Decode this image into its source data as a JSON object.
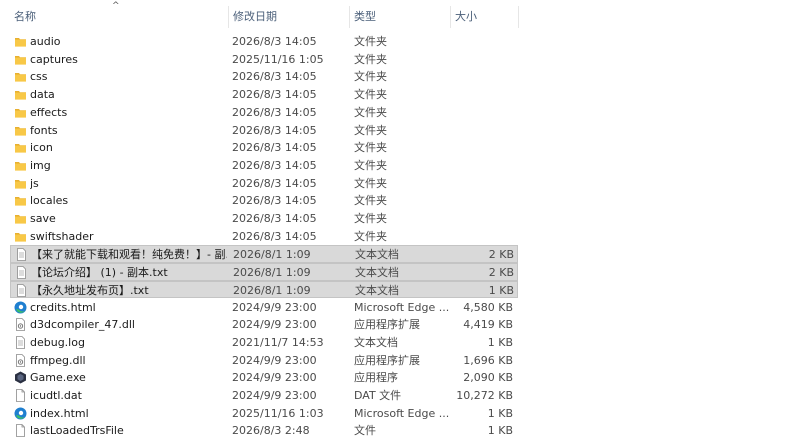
{
  "header": {
    "name": "名称",
    "date": "修改日期",
    "type": "类型",
    "size": "大小",
    "sort_arrow": "^"
  },
  "rows": [
    {
      "icon": "folder-icon",
      "name": "audio",
      "date": "2026/8/3 14:05",
      "type": "文件夹",
      "size": "",
      "selected": false
    },
    {
      "icon": "folder-icon",
      "name": "captures",
      "date": "2025/11/16 1:05",
      "type": "文件夹",
      "size": "",
      "selected": false
    },
    {
      "icon": "folder-icon",
      "name": "css",
      "date": "2026/8/3 14:05",
      "type": "文件夹",
      "size": "",
      "selected": false
    },
    {
      "icon": "folder-icon",
      "name": "data",
      "date": "2026/8/3 14:05",
      "type": "文件夹",
      "size": "",
      "selected": false
    },
    {
      "icon": "folder-icon",
      "name": "effects",
      "date": "2026/8/3 14:05",
      "type": "文件夹",
      "size": "",
      "selected": false
    },
    {
      "icon": "folder-icon",
      "name": "fonts",
      "date": "2026/8/3 14:05",
      "type": "文件夹",
      "size": "",
      "selected": false
    },
    {
      "icon": "folder-icon",
      "name": "icon",
      "date": "2026/8/3 14:05",
      "type": "文件夹",
      "size": "",
      "selected": false
    },
    {
      "icon": "folder-icon",
      "name": "img",
      "date": "2026/8/3 14:05",
      "type": "文件夹",
      "size": "",
      "selected": false
    },
    {
      "icon": "folder-icon",
      "name": "js",
      "date": "2026/8/3 14:05",
      "type": "文件夹",
      "size": "",
      "selected": false
    },
    {
      "icon": "folder-icon",
      "name": "locales",
      "date": "2026/8/3 14:05",
      "type": "文件夹",
      "size": "",
      "selected": false
    },
    {
      "icon": "folder-icon",
      "name": "save",
      "date": "2026/8/3 14:05",
      "type": "文件夹",
      "size": "",
      "selected": false
    },
    {
      "icon": "folder-icon",
      "name": "swiftshader",
      "date": "2026/8/3 14:05",
      "type": "文件夹",
      "size": "",
      "selected": false
    },
    {
      "icon": "text-document-icon",
      "name": "【来了就能下载和观看！纯免费！】- 副...",
      "date": "2026/8/1 1:09",
      "type": "文本文档",
      "size": "2 KB",
      "selected": true
    },
    {
      "icon": "text-document-icon",
      "name": "【论坛介绍】 (1) - 副本.txt",
      "date": "2026/8/1 1:09",
      "type": "文本文档",
      "size": "2 KB",
      "selected": true
    },
    {
      "icon": "text-document-icon",
      "name": "【永久地址发布页】.txt",
      "date": "2026/8/1 1:09",
      "type": "文本文档",
      "size": "1 KB",
      "selected": true
    },
    {
      "icon": "edge-html-icon",
      "name": "credits.html",
      "date": "2024/9/9 23:00",
      "type": "Microsoft Edge ...",
      "size": "4,580 KB",
      "selected": false
    },
    {
      "icon": "dll-icon",
      "name": "d3dcompiler_47.dll",
      "date": "2024/9/9 23:00",
      "type": "应用程序扩展",
      "size": "4,419 KB",
      "selected": false
    },
    {
      "icon": "text-document-icon",
      "name": "debug.log",
      "date": "2021/11/7 14:53",
      "type": "文本文档",
      "size": "1 KB",
      "selected": false
    },
    {
      "icon": "dll-icon",
      "name": "ffmpeg.dll",
      "date": "2024/9/9 23:00",
      "type": "应用程序扩展",
      "size": "1,696 KB",
      "selected": false
    },
    {
      "icon": "game-exe-icon",
      "name": "Game.exe",
      "date": "2024/9/9 23:00",
      "type": "应用程序",
      "size": "2,090 KB",
      "selected": false
    },
    {
      "icon": "blank-file-icon",
      "name": "icudtl.dat",
      "date": "2024/9/9 23:00",
      "type": "DAT 文件",
      "size": "10,272 KB",
      "selected": false
    },
    {
      "icon": "edge-html-icon",
      "name": "index.html",
      "date": "2025/11/16 1:03",
      "type": "Microsoft Edge ...",
      "size": "1 KB",
      "selected": false
    },
    {
      "icon": "blank-file-icon",
      "name": "lastLoadedTrsFile",
      "date": "2026/8/3 2:48",
      "type": "文件",
      "size": "1 KB",
      "selected": false
    }
  ],
  "colors": {
    "folder": "#f8c847",
    "folder_tab": "#e8b030",
    "selection": "#d9d9d9",
    "edge_blue": "#1f7fd0",
    "edge_green": "#3bbf6a",
    "header_text": "#4c607a"
  }
}
